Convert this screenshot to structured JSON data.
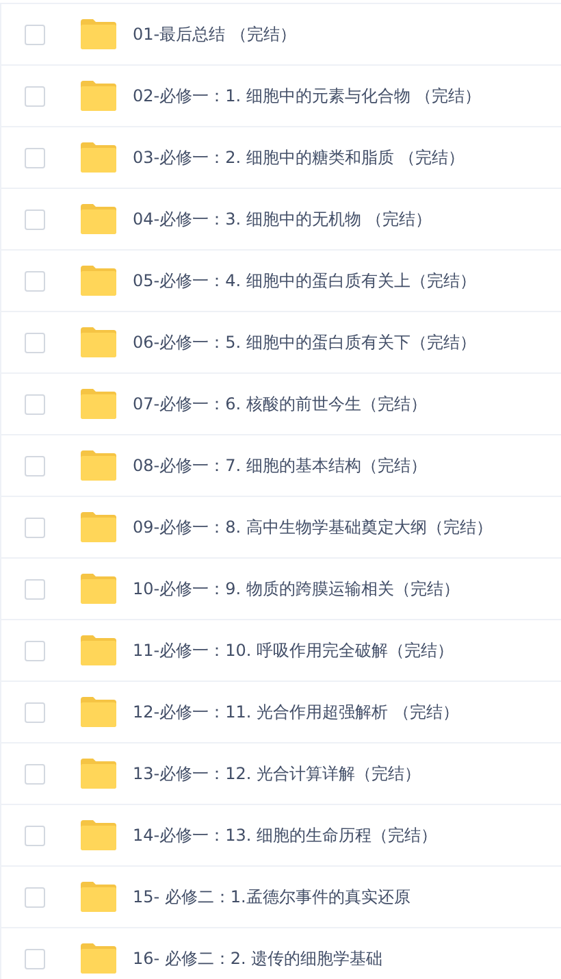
{
  "files": [
    {
      "name": "01-最后总结 （完结）",
      "checked": false
    },
    {
      "name": "02-必修一：1. 细胞中的元素与化合物 （完结）",
      "checked": false
    },
    {
      "name": "03-必修一：2. 细胞中的糖类和脂质 （完结）",
      "checked": false
    },
    {
      "name": "04-必修一：3. 细胞中的无机物 （完结）",
      "checked": false
    },
    {
      "name": "05-必修一：4. 细胞中的蛋白质有关上（完结）",
      "checked": false
    },
    {
      "name": "06-必修一：5. 细胞中的蛋白质有关下（完结）",
      "checked": false
    },
    {
      "name": "07-必修一：6. 核酸的前世今生（完结）",
      "checked": false
    },
    {
      "name": "08-必修一：7. 细胞的基本结构（完结）",
      "checked": false
    },
    {
      "name": "09-必修一：8. 高中生物学基础奠定大纲（完结）",
      "checked": false
    },
    {
      "name": "10-必修一：9. 物质的跨膜运输相关（完结）",
      "checked": false
    },
    {
      "name": "11-必修一：10. 呼吸作用完全破解（完结）",
      "checked": false
    },
    {
      "name": "12-必修一：11. 光合作用超强解析 （完结）",
      "checked": false
    },
    {
      "name": "13-必修一：12. 光合计算详解（完结）",
      "checked": false
    },
    {
      "name": "14-必修一：13. 细胞的生命历程（完结）",
      "checked": false
    },
    {
      "name": "15- 必修二：1.孟德尔事件的真实还原",
      "checked": false
    },
    {
      "name": "16- 必修二：2. 遗传的细胞学基础",
      "checked": false
    }
  ]
}
